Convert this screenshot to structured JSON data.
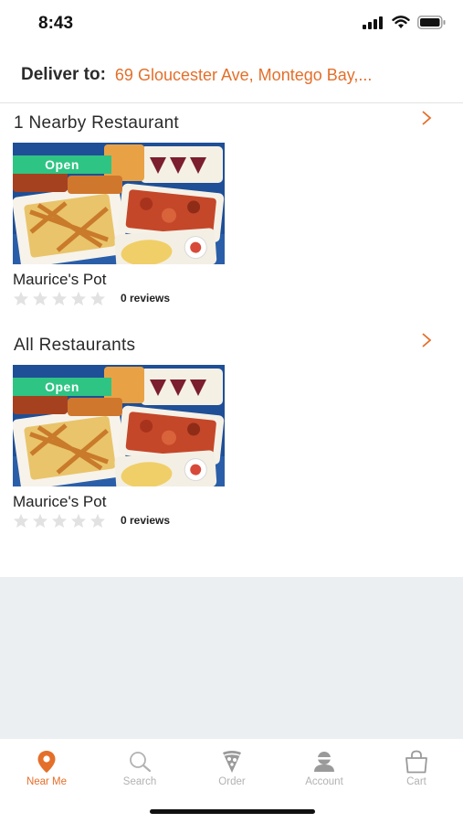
{
  "status": {
    "time": "8:43"
  },
  "header": {
    "deliver_label": "Deliver to:",
    "address": "69 Gloucester Ave, Montego Bay,..."
  },
  "sections": [
    {
      "title": "1 Nearby Restaurant",
      "restaurant": {
        "name": "Maurice's Pot",
        "badge": "Open",
        "rating": 0,
        "reviews_label": "0 reviews"
      }
    },
    {
      "title": "All Restaurants",
      "restaurant": {
        "name": "Maurice's Pot",
        "badge": "Open",
        "rating": 0,
        "reviews_label": "0 reviews"
      }
    }
  ],
  "tabbar": {
    "tabs": [
      {
        "label": "Near Me",
        "icon": "location-pin-icon",
        "active": true
      },
      {
        "label": "Search",
        "icon": "search-icon",
        "active": false
      },
      {
        "label": "Order",
        "icon": "pizza-slice-icon",
        "active": false
      },
      {
        "label": "Account",
        "icon": "user-icon",
        "active": false
      },
      {
        "label": "Cart",
        "icon": "shopping-bag-icon",
        "active": false
      }
    ]
  },
  "colors": {
    "accent": "#e46f2a",
    "open_badge": "#2ec483",
    "background_grey": "#eceff2",
    "inactive_tab": "#b2b2b2"
  }
}
